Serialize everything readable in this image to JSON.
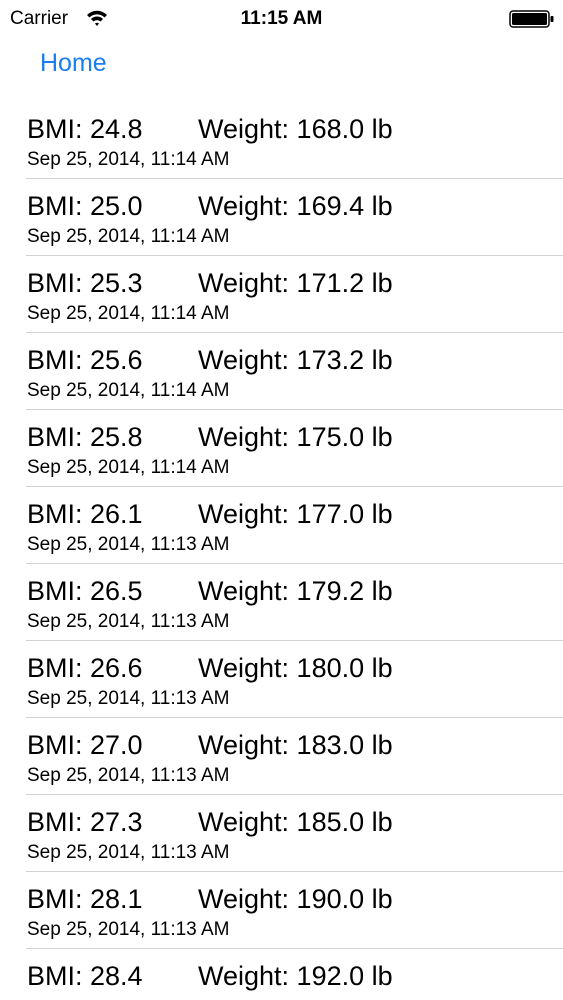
{
  "status_bar": {
    "carrier": "Carrier",
    "time": "11:15 AM",
    "wifi_icon": "wifi-icon",
    "battery_icon": "battery-icon"
  },
  "nav": {
    "back_label": "Home",
    "accent_color": "#1a7ef0"
  },
  "entries": [
    {
      "bmi": "BMI: 24.8",
      "weight": "Weight: 168.0 lb",
      "date": "Sep 25, 2014, 11:14 AM"
    },
    {
      "bmi": "BMI: 25.0",
      "weight": "Weight: 169.4 lb",
      "date": "Sep 25, 2014, 11:14 AM"
    },
    {
      "bmi": "BMI: 25.3",
      "weight": "Weight: 171.2 lb",
      "date": "Sep 25, 2014, 11:14 AM"
    },
    {
      "bmi": "BMI: 25.6",
      "weight": "Weight: 173.2 lb",
      "date": "Sep 25, 2014, 11:14 AM"
    },
    {
      "bmi": "BMI: 25.8",
      "weight": "Weight: 175.0 lb",
      "date": "Sep 25, 2014, 11:14 AM"
    },
    {
      "bmi": "BMI: 26.1",
      "weight": "Weight: 177.0 lb",
      "date": "Sep 25, 2014, 11:13 AM"
    },
    {
      "bmi": "BMI: 26.5",
      "weight": "Weight: 179.2 lb",
      "date": "Sep 25, 2014, 11:13 AM"
    },
    {
      "bmi": "BMI: 26.6",
      "weight": "Weight: 180.0 lb",
      "date": "Sep 25, 2014, 11:13 AM"
    },
    {
      "bmi": "BMI: 27.0",
      "weight": "Weight: 183.0 lb",
      "date": "Sep 25, 2014, 11:13 AM"
    },
    {
      "bmi": "BMI: 27.3",
      "weight": "Weight: 185.0 lb",
      "date": "Sep 25, 2014, 11:13 AM"
    },
    {
      "bmi": "BMI: 28.1",
      "weight": "Weight: 190.0 lb",
      "date": "Sep 25, 2014, 11:13 AM"
    },
    {
      "bmi": "BMI: 28.4",
      "weight": "Weight: 192.0 lb",
      "date": ""
    }
  ]
}
